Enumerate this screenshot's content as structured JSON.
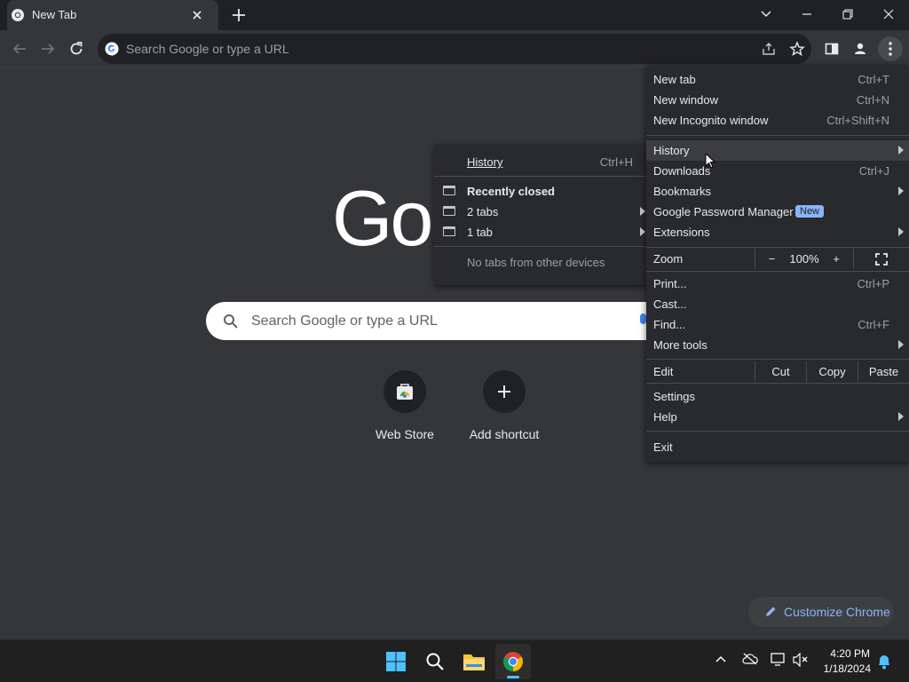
{
  "colors": {
    "chrome_frame": "#202124",
    "toolbar": "#35363a",
    "menu_bg": "#292a2d",
    "accent": "#8ab4f8",
    "taskbar": "#202020"
  },
  "tab": {
    "title": "New Tab",
    "icon": "chrome-favicon-icon"
  },
  "omnibox": {
    "placeholder": "Search Google or type a URL"
  },
  "ntp": {
    "logo_text": "Go",
    "search_placeholder": "Search Google or type a URL",
    "shortcuts": [
      {
        "label": "Web Store",
        "icon": "webstore-icon"
      },
      {
        "label": "Add shortcut",
        "icon": "plus-icon"
      }
    ],
    "customize_label": "Customize Chrome"
  },
  "history_submenu": {
    "history": {
      "label": "History",
      "shortcut": "Ctrl+H"
    },
    "recently_closed": "Recently closed",
    "items": [
      {
        "label": "2 tabs"
      },
      {
        "label": "1 tab"
      }
    ],
    "no_devices": "No tabs from other devices"
  },
  "main_menu": {
    "new_tab": {
      "label": "New tab",
      "shortcut": "Ctrl+T"
    },
    "new_window": {
      "label": "New window",
      "shortcut": "Ctrl+N"
    },
    "new_incognito": {
      "label": "New Incognito window",
      "shortcut": "Ctrl+Shift+N"
    },
    "history": {
      "label": "History"
    },
    "downloads": {
      "label": "Downloads",
      "shortcut": "Ctrl+J"
    },
    "bookmarks": {
      "label": "Bookmarks"
    },
    "password_manager": {
      "label": "Google Password Manager",
      "badge": "New"
    },
    "extensions": {
      "label": "Extensions"
    },
    "zoom": {
      "label": "Zoom",
      "minus": "−",
      "value": "100%",
      "plus": "+"
    },
    "print": {
      "label": "Print...",
      "shortcut": "Ctrl+P"
    },
    "cast": {
      "label": "Cast..."
    },
    "find": {
      "label": "Find...",
      "shortcut": "Ctrl+F"
    },
    "more_tools": {
      "label": "More tools"
    },
    "edit": {
      "label": "Edit",
      "cut": "Cut",
      "copy": "Copy",
      "paste": "Paste"
    },
    "settings": {
      "label": "Settings"
    },
    "help": {
      "label": "Help"
    },
    "exit": {
      "label": "Exit"
    }
  },
  "taskbar": {
    "apps": [
      "windows-start-icon",
      "search-icon",
      "file-explorer-icon",
      "chrome-icon"
    ],
    "time": "4:20 PM",
    "date": "1/18/2024"
  }
}
